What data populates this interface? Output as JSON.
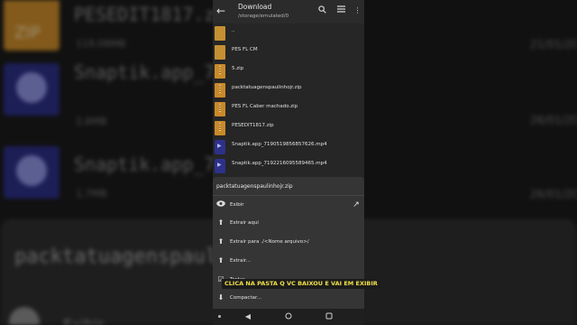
{
  "background": {
    "rows": [
      {
        "name": "PESEDIT1817.zip",
        "size": "119,08MB",
        "date": "21/01/20",
        "type": "zip"
      },
      {
        "name": "Snaptik.app_719051",
        "size": "2,6MB",
        "date": "26/01/20",
        "type": "video"
      },
      {
        "name": "Snaptik.app_719221",
        "size": "1,7MB",
        "date": "26/01/20",
        "type": "video"
      }
    ],
    "sheet_title": "packtatuagenspaulinho",
    "sheet_action": "Exibir"
  },
  "appbar": {
    "title": "Download",
    "path": "/storage/emulated/0",
    "icons": [
      "arrow-back-icon",
      "search-icon",
      "list-view-icon",
      "more-vert-icon"
    ]
  },
  "files": [
    {
      "name": "..",
      "size": "",
      "date": "",
      "type": "folder"
    },
    {
      "name": "PES FL CM",
      "size": "",
      "date": "",
      "type": "folder"
    },
    {
      "name": "5.zip",
      "size": "",
      "date": "",
      "type": "zip"
    },
    {
      "name": "packtatuagenspaulinhojr.zip",
      "size": "",
      "date": "",
      "type": "zip"
    },
    {
      "name": "PES FL Caber machado.zip",
      "size": "",
      "date": "",
      "type": "zip"
    },
    {
      "name": "PESEDIT1817.zip",
      "size": "",
      "date": "",
      "type": "zip"
    },
    {
      "name": "Snaptik.app_7190519856857626.mp4",
      "size": "",
      "date": "",
      "type": "video"
    },
    {
      "name": "Snaptik.app_7192216095589465.mp4",
      "size": "",
      "date": "",
      "type": "video"
    }
  ],
  "sheet": {
    "title": "packtatuagenspaulinhojr.zip",
    "items": [
      {
        "label": "Exibir",
        "icon": "eye-icon"
      },
      {
        "label": "Extrair aqui",
        "icon": "upload-arrow-icon"
      },
      {
        "label": "Extrair para ./<Nome arquivo>/",
        "icon": "upload-arrow-icon"
      },
      {
        "label": "Extrair...",
        "icon": "upload-arrow-icon"
      },
      {
        "label": "Testar",
        "icon": "checkbox-icon"
      },
      {
        "label": "Compactar...",
        "icon": "download-arrow-icon"
      }
    ]
  },
  "caption": "CLICA NA PASTA Q VC BAIXOU E VAI EM EXIBIR",
  "colors": {
    "caption_text": "#f1e04a",
    "zip_icon": "#c98a2a",
    "video_icon": "#2d318a"
  }
}
